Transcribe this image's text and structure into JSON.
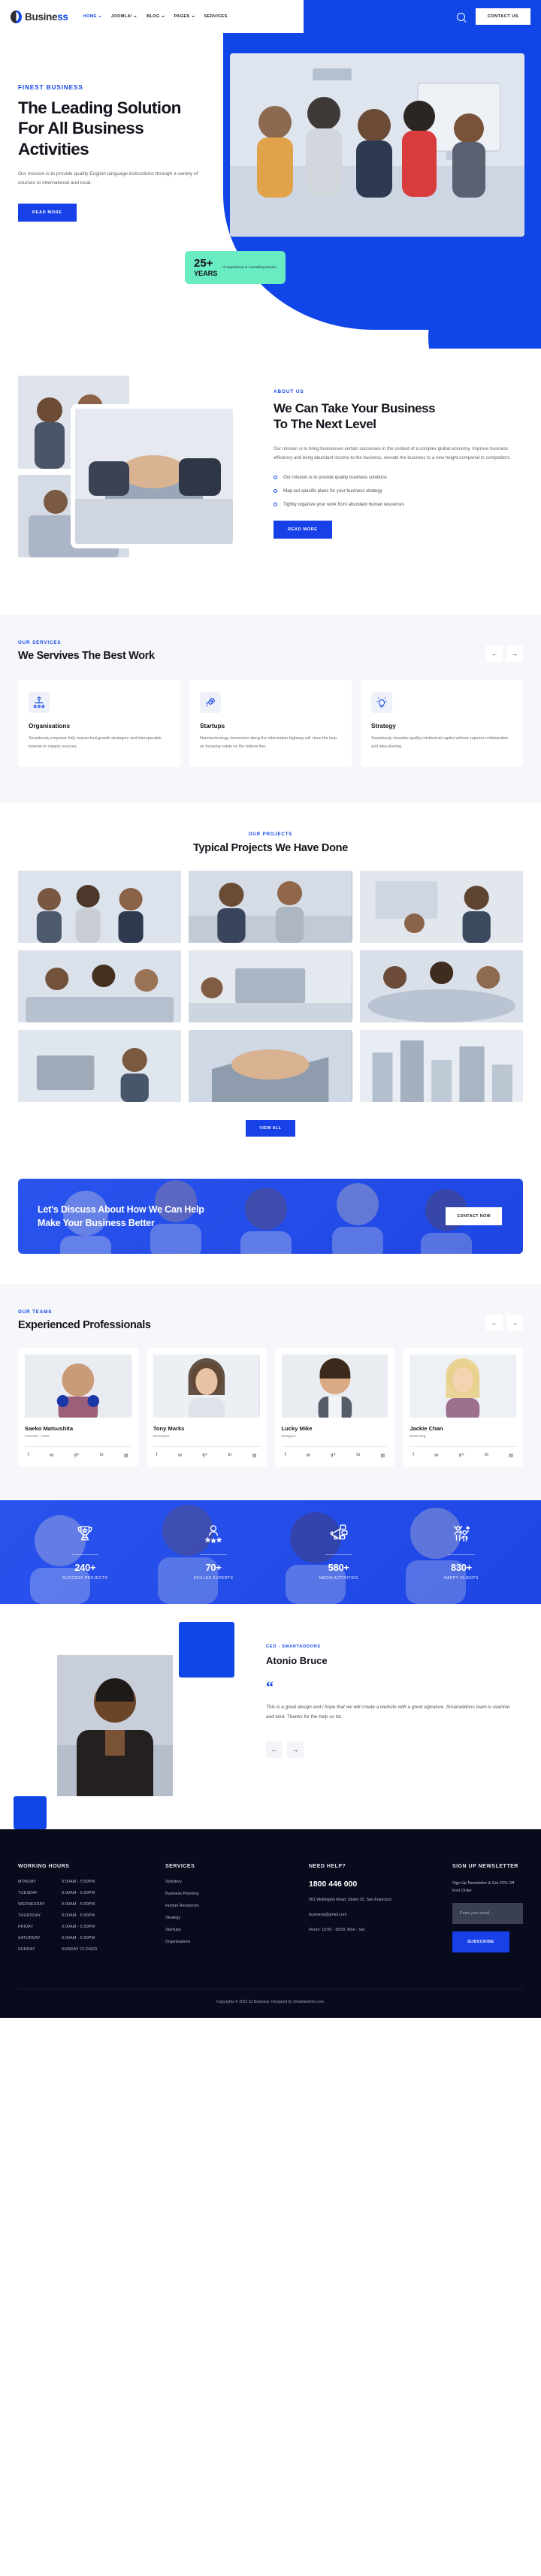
{
  "header": {
    "brand": {
      "name_dark": "Busine",
      "name_accent": "ss",
      "logo_icon": "circle-split-logo"
    },
    "nav": [
      {
        "label": "HOME",
        "has_caret": true,
        "active": true
      },
      {
        "label": "JOOMLA!",
        "has_caret": true,
        "active": false
      },
      {
        "label": "BLOG",
        "has_caret": true,
        "active": false
      },
      {
        "label": "PAGES",
        "has_caret": true,
        "active": false
      },
      {
        "label": "SERVICES",
        "has_caret": false,
        "active": false
      }
    ],
    "search_icon": "search-icon",
    "contact_button": "CONTACT US"
  },
  "hero": {
    "eyebrow": "FINEST BUSINESS",
    "title_line1": "The Leading Solution",
    "title_line2": "For All Business",
    "title_line3": "Activities",
    "paragraph": "Our mission is to provide quality English language instructions through a variety of courses to international and local.",
    "button": "READ MORE",
    "badge": {
      "number": "25+",
      "years": "YEARS",
      "meta": "of experience in consulting service"
    }
  },
  "about": {
    "eyebrow": "ABOUT US",
    "title_line1": "We Can Take Your Business",
    "title_line2": "To The Next Level",
    "paragraph": "Our mission is to bring businesses certain successes in the context of a complex global economy. Improve business efficiency and bring abundant income to the business, elevate the business to a new height compared to competitors.",
    "bullets": [
      "Our mission is to provide quality business solutions",
      "Map out specific plans for your business strategy",
      "Tightly organize your work from abundant human resources"
    ],
    "button": "READ MORE"
  },
  "services": {
    "eyebrow": "OUR SERVICES",
    "title": "We Servives The Best Work",
    "prev_label": "←",
    "next_label": "→",
    "cards": [
      {
        "icon": "org-chart-icon",
        "glyph": "⛭",
        "title": "Organisations",
        "desc": "Seamlessly empower fully researched growth strategies and interoperable internal or organic sources."
      },
      {
        "icon": "rocket-icon",
        "glyph": "➚",
        "title": "Startups",
        "desc": "Nanotechnology immersion along the information highway will close the loop on focusing solely on the bottom line."
      },
      {
        "icon": "lightbulb-icon",
        "glyph": "☀",
        "title": "Strategy",
        "desc": "Seamlessly visualize quality intellectual capital without superior collaboration and idea-sharing."
      }
    ]
  },
  "projects": {
    "eyebrow": "OUR PROJECTS",
    "title": "Typical Projects We Have Done",
    "items": [
      "project-team-meeting",
      "project-office-discussion",
      "project-presentation",
      "project-board-room",
      "project-workspace",
      "project-conference-table",
      "project-laptop-work",
      "project-handshake",
      "project-city-skyline"
    ],
    "button": "VIEW ALL"
  },
  "cta": {
    "title_line1": "Let's Discuss About How We Can Help",
    "title_line2": "Make Your Business Better",
    "button": "CONTACT NOW"
  },
  "team": {
    "eyebrow": "OUR TEAMS",
    "title": "Experienced Professionals",
    "prev_label": "←",
    "next_label": "→",
    "members": [
      {
        "name": "Saeko Matsushita",
        "role": "Founder - CEO"
      },
      {
        "name": "Tony Marks",
        "role": "Developer"
      },
      {
        "name": "Lucky Mike",
        "role": "Designer"
      },
      {
        "name": "Jackie Chan",
        "role": "Marketing"
      }
    ],
    "socials": [
      "f",
      "✉",
      "g+",
      "in",
      "▤"
    ]
  },
  "stats": [
    {
      "icon": "trophy-icon",
      "glyph": "♜",
      "number": "240+",
      "label": "SUCCESS PROJECTS"
    },
    {
      "icon": "person-stars-icon",
      "glyph": "☆",
      "number": "70+",
      "label": "SKILLED EXPERTS"
    },
    {
      "icon": "megaphone-icon",
      "glyph": "✉",
      "number": "580+",
      "label": "MEDIA ACTIVITIES"
    },
    {
      "icon": "celebrate-icon",
      "glyph": "✨",
      "number": "830+",
      "label": "HAPPY CLIENTS"
    }
  ],
  "testimonial": {
    "eyebrow": "CEO - SMARTADDONS",
    "name": "Atonio Bruce",
    "quote_icon": "quote-mark-icon",
    "quote": "This is a great design and i hope that we will create a website with a good signature. Smartaddons team is reactive and kind. Thanks for the help so far.",
    "prev_label": "←",
    "next_label": "→"
  },
  "footer": {
    "working_hours": {
      "heading": "WORKING HOURS",
      "rows": [
        {
          "day": "MONDAY",
          "time": "9:00AM - 5:00PM"
        },
        {
          "day": "TUESDAY",
          "time": "9:00AM - 5:00PM"
        },
        {
          "day": "WEDNESDAY",
          "time": "9:00AM - 5:00PM"
        },
        {
          "day": "THURSDAY",
          "time": "9:00AM - 5:00PM"
        },
        {
          "day": "FRIDAY",
          "time": "9:00AM - 5:00PM"
        },
        {
          "day": "SATURDAY",
          "time": "9:00AM - 5:00PM"
        },
        {
          "day": "SUNDAY",
          "time": "SUNDAY CLOSED"
        }
      ]
    },
    "services": {
      "heading": "SERVICES",
      "items": [
        "Solicitory",
        "Business Planning",
        "Human Resources",
        "Strategy",
        "StartUps",
        "Organisations"
      ]
    },
    "help": {
      "heading": "NEED HELP?",
      "phone": "1800 446 000",
      "address": "561 Wellington Road, Street 32, San Francisco",
      "email": "business@gmail.com",
      "hours": "Hours: 10:00 - 18:00, Mon - Sat"
    },
    "newsletter": {
      "heading": "SIGN UP NEWSLETTER",
      "subtext": "Sign Up Newsletter & Get 20% Off First Order",
      "placeholder": "Enter your email...",
      "button": "SUBSCRIBE"
    },
    "copyright": "Copyrights © 2023 SJ Business. Designed by Smartaddons.com."
  },
  "colors": {
    "accent": "#1046e8",
    "accent_btn": "#1840e8",
    "mint": "#69ecc2",
    "footer_bg": "#080b1c",
    "light_bg": "#f6f7fa"
  }
}
